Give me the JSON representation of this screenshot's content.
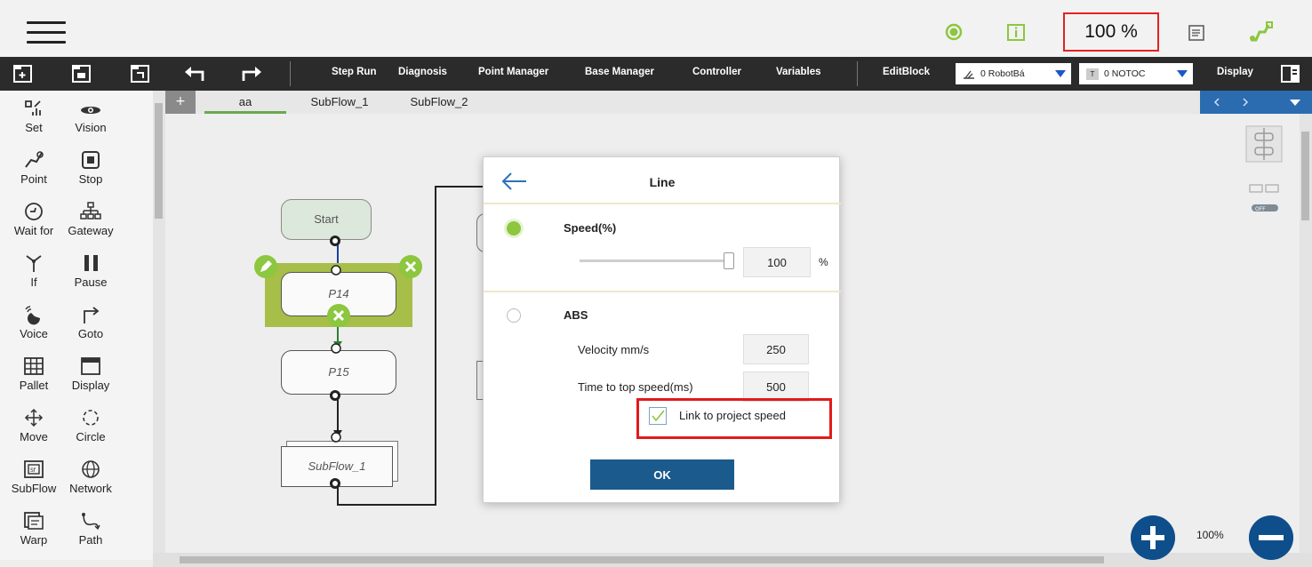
{
  "topbar": {
    "speed": "100 %",
    "icons": [
      "menu-icon",
      "connection-status-icon",
      "info-icon",
      "log-icon",
      "robot-status-icon"
    ]
  },
  "toolbar": {
    "icons": [
      "new-file-icon",
      "open-file-icon",
      "save-file-icon",
      "undo-icon",
      "redo-icon"
    ],
    "items": [
      "Step Run",
      "Diagnosis",
      "Point Manager",
      "Base Manager",
      "Controller",
      "Variables",
      "EditBlock"
    ],
    "robot_base_dropdown": "0 RobotBá",
    "tool_dropdown": "0 NOTOC",
    "display_label": "Display"
  },
  "palette": {
    "items": [
      {
        "label": "Set",
        "icon": "set-icon"
      },
      {
        "label": "Vision",
        "icon": "vision-icon"
      },
      {
        "label": "Point",
        "icon": "point-icon"
      },
      {
        "label": "Stop",
        "icon": "stop-icon"
      },
      {
        "label": "Wait for",
        "icon": "wait-for-icon"
      },
      {
        "label": "Gateway",
        "icon": "gateway-icon"
      },
      {
        "label": "If",
        "icon": "if-icon"
      },
      {
        "label": "Pause",
        "icon": "pause-icon"
      },
      {
        "label": "Voice",
        "icon": "voice-icon"
      },
      {
        "label": "Goto",
        "icon": "goto-icon"
      },
      {
        "label": "Pallet",
        "icon": "pallet-icon"
      },
      {
        "label": "Display",
        "icon": "display-icon"
      },
      {
        "label": "Move",
        "icon": "move-icon"
      },
      {
        "label": "Circle",
        "icon": "circle-icon"
      },
      {
        "label": "SubFlow",
        "icon": "subflow-icon"
      },
      {
        "label": "Network",
        "icon": "network-icon"
      },
      {
        "label": "Warp",
        "icon": "warp-icon"
      },
      {
        "label": "Path",
        "icon": "path-icon"
      }
    ]
  },
  "tabs": {
    "plus": "+",
    "items": [
      "aa",
      "SubFlow_1",
      "SubFlow_2"
    ],
    "active": "aa"
  },
  "flow": {
    "start": "Start",
    "nodes": [
      "P14",
      "P15",
      "SubFlow_1"
    ]
  },
  "dialog": {
    "title": "Line",
    "speed_label": "Speed(%)",
    "speed_value": "100",
    "speed_unit": "%",
    "speed_slider_fraction": 1.0,
    "abs_label": "ABS",
    "velocity_label": "Velocity mm/s",
    "velocity_value": "250",
    "time_label": "Time to top speed(ms)",
    "time_value": "500",
    "link_label": "Link to project speed",
    "link_checked": true,
    "ok_label": "OK"
  },
  "zoom": {
    "level": "100%"
  },
  "colors": {
    "toolbar_bg": "#2b2b2b",
    "accent_green": "#8dc63f",
    "ok_blue": "#1a5a8c",
    "highlight_red": "#e01b1b"
  }
}
